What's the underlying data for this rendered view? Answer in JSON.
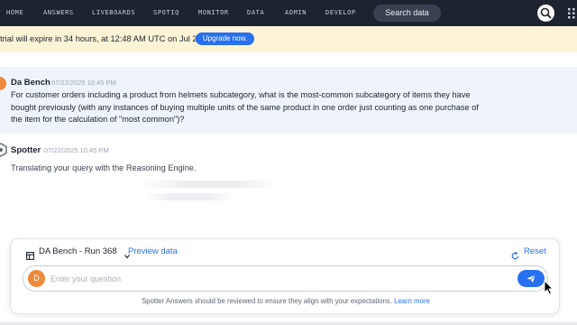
{
  "nav": {
    "items": [
      "HOME",
      "ANSWERS",
      "LIVEBOARDS",
      "SPOTIQ",
      "MONITOR",
      "DATA",
      "ADMIN",
      "DEVELOP"
    ],
    "search_label": "Search data"
  },
  "banner": {
    "text": "trial will expire in 34 hours, at 12:48 AM UTC on Jul 24.",
    "button": "Upgrade now."
  },
  "messages": {
    "user": {
      "name": "Da Bench",
      "time": "07/22/2025 10:45 PM",
      "text": "For customer orders including a product from helmets subcategory, what is the most-common subcategory of items they have bought previously (with any instances of buying multiple units of the same product in one order just counting as one purchase of the item for the calculation of \"most common\")?"
    },
    "bot": {
      "name": "Spotter",
      "time": "07/22/2025 10:45 PM",
      "status": "Translating your query with the Reasoning Engine."
    }
  },
  "composer": {
    "datasource": "DA Bench - Run 368",
    "preview": "Preview data",
    "reset": "Reset",
    "avatar_letter": "D",
    "placeholder": "Enter your question",
    "disclaimer": "Spotter Answers should be reviewed to ensure they align with your expectations.",
    "learn_more": "Learn more"
  },
  "colors": {
    "accent": "#2770ef",
    "nav_bg": "#1d232f",
    "banner_bg": "#fdf3d7",
    "avatar": "#f08a3c"
  }
}
